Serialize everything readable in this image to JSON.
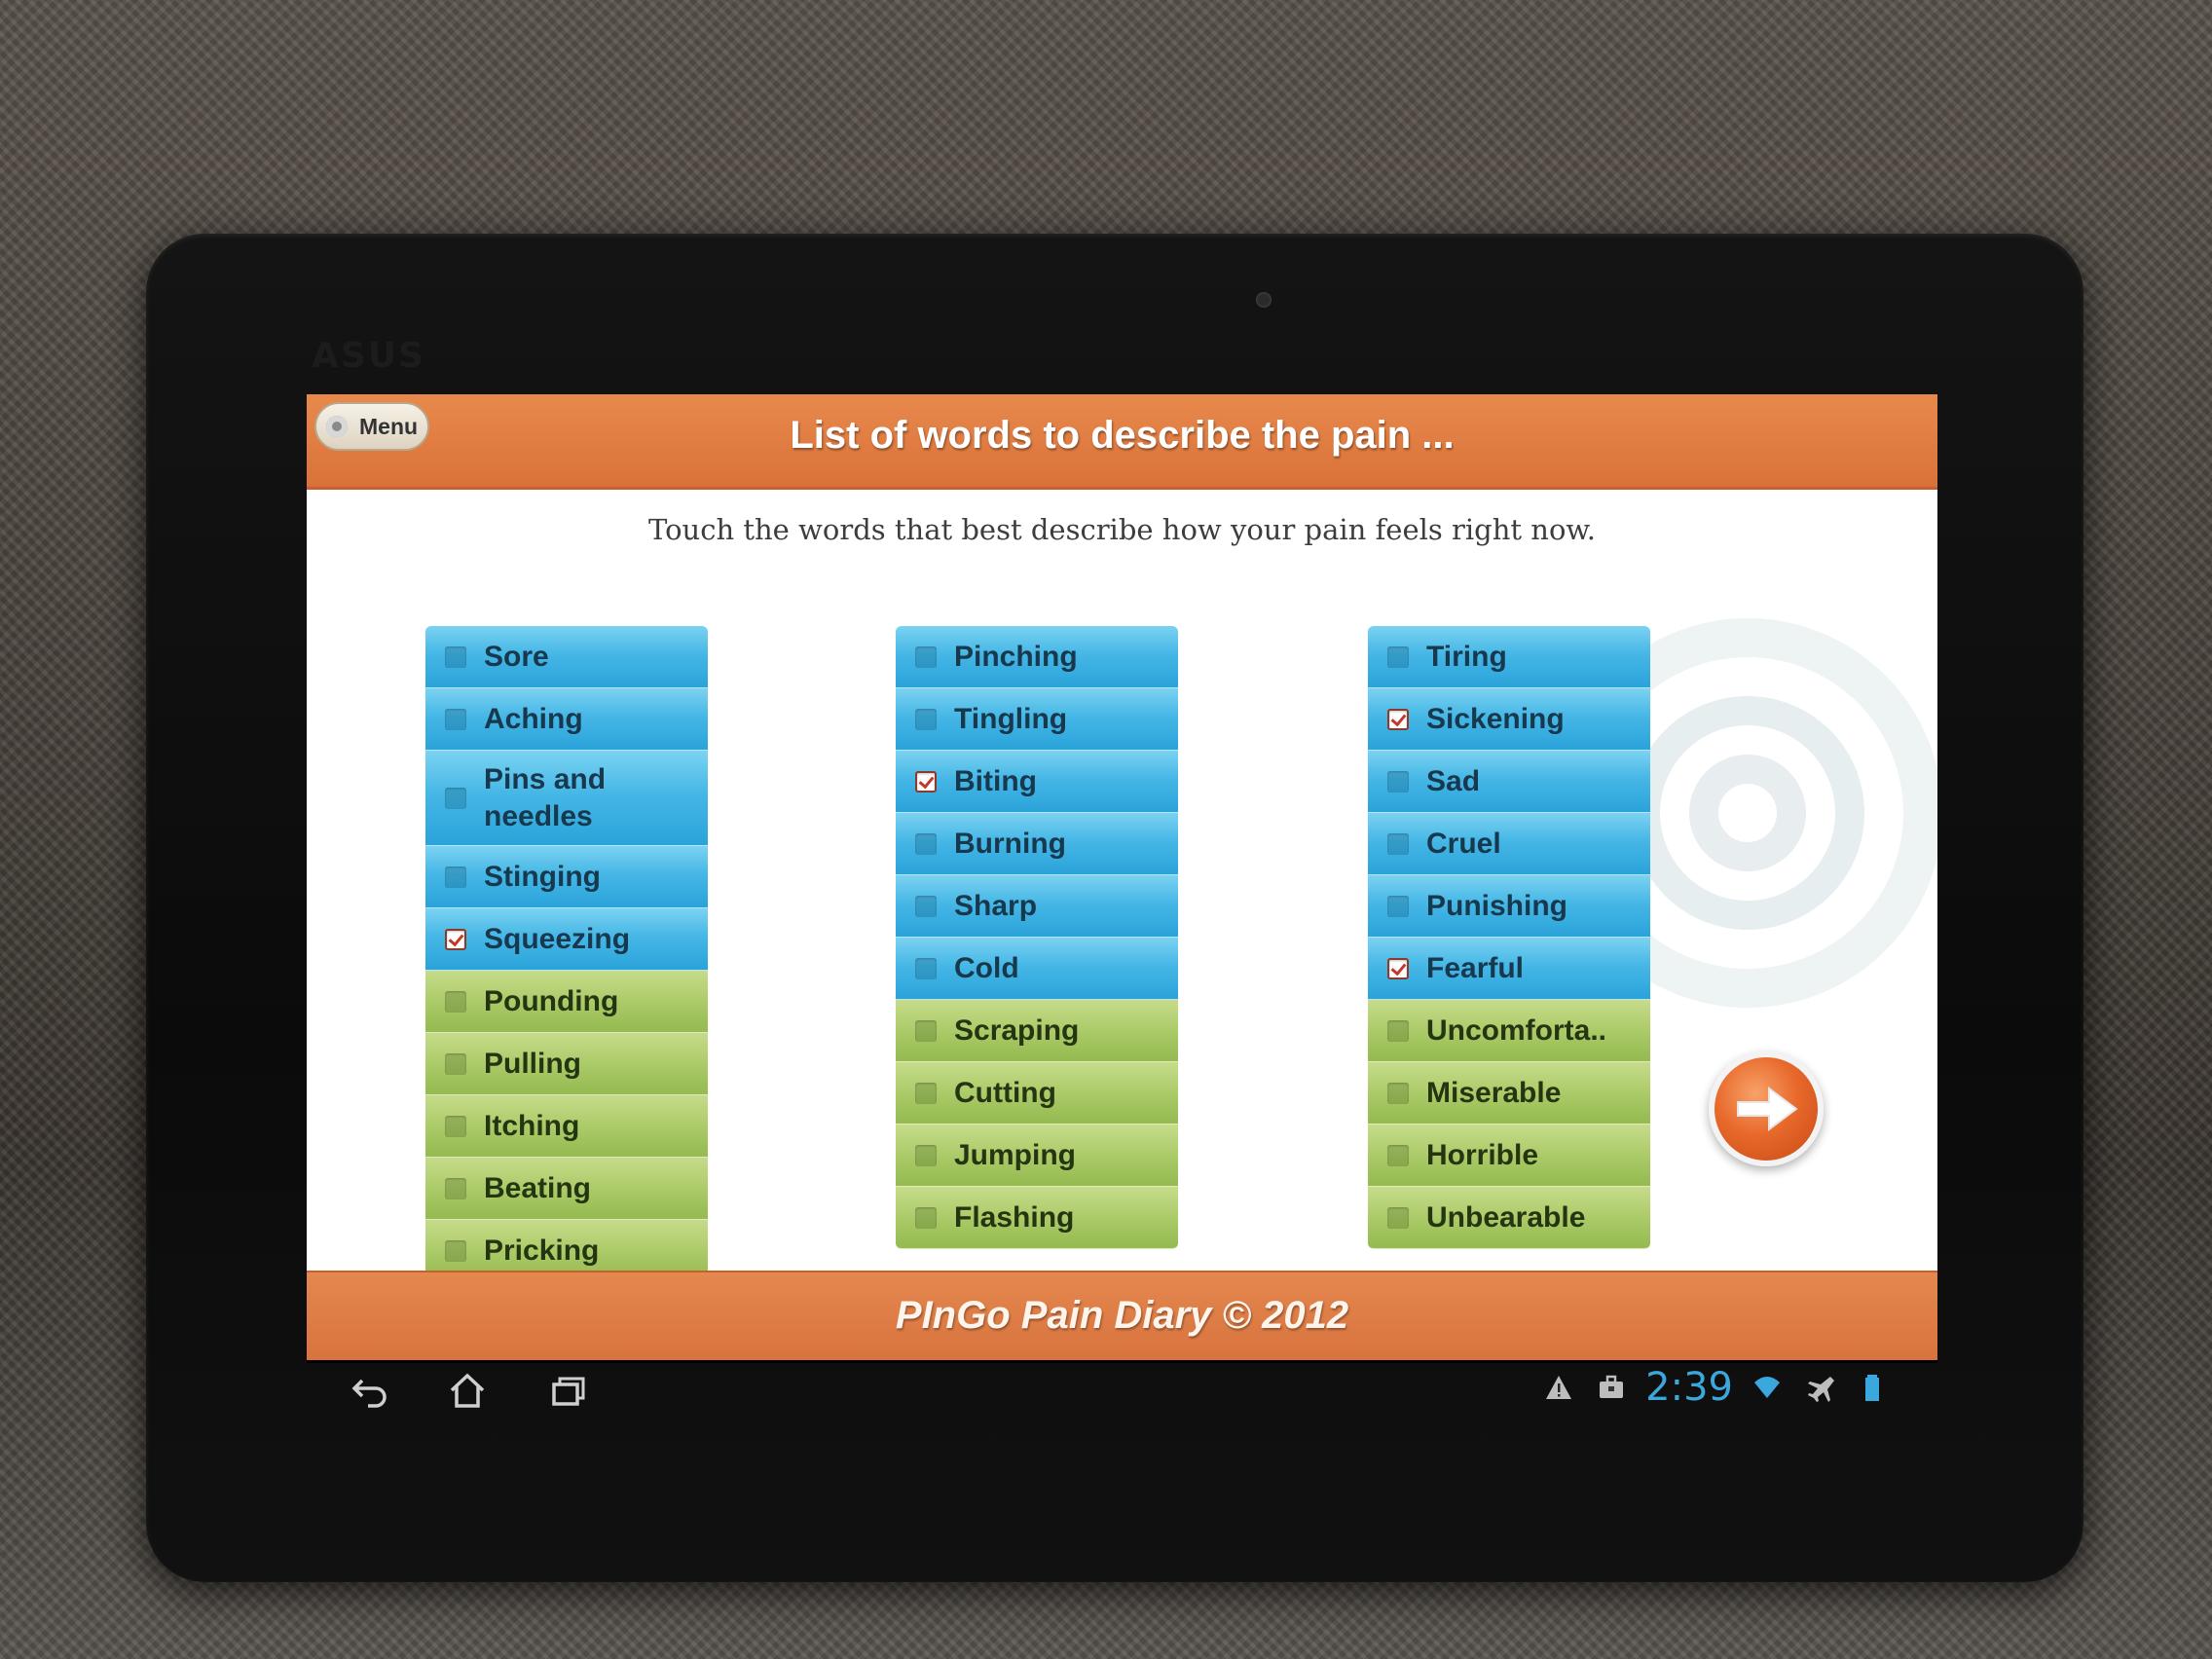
{
  "header": {
    "menu_label": "Menu",
    "title": "List of words to describe the pain ..."
  },
  "instruction": "Touch the words that best describe how your pain feels right now.",
  "columns": [
    {
      "items": [
        {
          "label": "Sore",
          "checked": false,
          "color": "blue"
        },
        {
          "label": "Aching",
          "checked": false,
          "color": "blue"
        },
        {
          "label": "Pins and needles",
          "checked": false,
          "color": "blue"
        },
        {
          "label": "Stinging",
          "checked": false,
          "color": "blue"
        },
        {
          "label": "Squeezing",
          "checked": true,
          "color": "blue"
        },
        {
          "label": "Pounding",
          "checked": false,
          "color": "green"
        },
        {
          "label": "Pulling",
          "checked": false,
          "color": "green"
        },
        {
          "label": "Itching",
          "checked": false,
          "color": "green"
        },
        {
          "label": "Beating",
          "checked": false,
          "color": "green"
        },
        {
          "label": "Pricking",
          "checked": false,
          "color": "green"
        }
      ]
    },
    {
      "items": [
        {
          "label": "Pinching",
          "checked": false,
          "color": "blue"
        },
        {
          "label": "Tingling",
          "checked": false,
          "color": "blue"
        },
        {
          "label": "Biting",
          "checked": true,
          "color": "blue"
        },
        {
          "label": "Burning",
          "checked": false,
          "color": "blue"
        },
        {
          "label": "Sharp",
          "checked": false,
          "color": "blue"
        },
        {
          "label": "Cold",
          "checked": false,
          "color": "blue"
        },
        {
          "label": "Scraping",
          "checked": false,
          "color": "green"
        },
        {
          "label": "Cutting",
          "checked": false,
          "color": "green"
        },
        {
          "label": "Jumping",
          "checked": false,
          "color": "green"
        },
        {
          "label": "Flashing",
          "checked": false,
          "color": "green"
        }
      ]
    },
    {
      "items": [
        {
          "label": "Tiring",
          "checked": false,
          "color": "blue"
        },
        {
          "label": "Sickening",
          "checked": true,
          "color": "blue"
        },
        {
          "label": "Sad",
          "checked": false,
          "color": "blue"
        },
        {
          "label": "Cruel",
          "checked": false,
          "color": "blue"
        },
        {
          "label": "Punishing",
          "checked": false,
          "color": "blue"
        },
        {
          "label": "Fearful",
          "checked": true,
          "color": "blue"
        },
        {
          "label": "Uncomforta..",
          "checked": false,
          "color": "green"
        },
        {
          "label": "Miserable",
          "checked": false,
          "color": "green"
        },
        {
          "label": "Horrible",
          "checked": false,
          "color": "green"
        },
        {
          "label": "Unbearable",
          "checked": false,
          "color": "green"
        }
      ]
    }
  ],
  "next_button": {
    "icon": "arrow-right-icon"
  },
  "footer": {
    "text": "PInGo Pain Diary © 2012"
  },
  "device": {
    "brand": "ASUS"
  },
  "status_bar": {
    "time": "2:39",
    "icons": [
      "warning-icon",
      "briefcase-icon",
      "wifi-icon",
      "airplane-icon",
      "battery-icon"
    ]
  },
  "nav_bar": {
    "icons": [
      "back-icon",
      "home-icon",
      "recent-apps-icon"
    ]
  },
  "colors": {
    "header_orange": "#d9723a",
    "item_blue": "#46b7e6",
    "item_green": "#a9c966",
    "check_red": "#c0392b",
    "clock_blue": "#3aa7dd"
  }
}
